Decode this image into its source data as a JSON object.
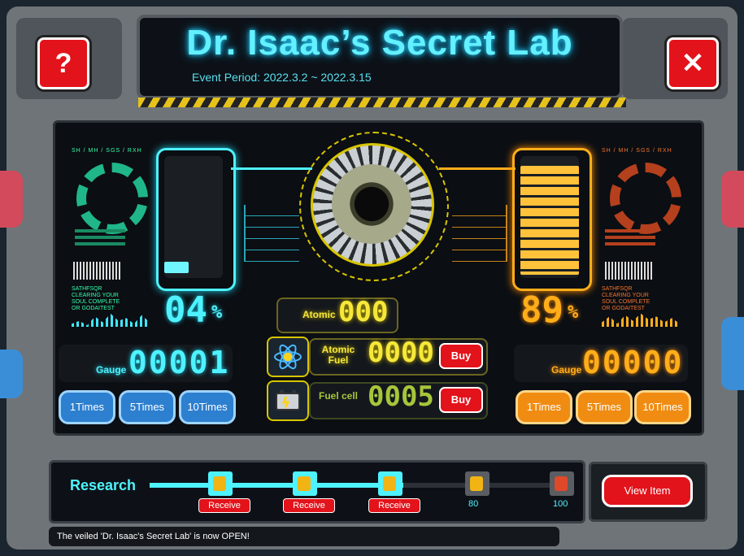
{
  "header": {
    "title": "Dr. Isaac’s Secret Lab",
    "event_period": "Event Period: 2022.3.2 ~ 2022.3.15"
  },
  "buttons": {
    "help_glyph": "?",
    "close_glyph": "✕"
  },
  "left": {
    "percent": "04",
    "percent_sign": "%",
    "gauge_label": "Gauge",
    "gauge_value": "00001",
    "fill_fraction": 0.04,
    "times": [
      "1Times",
      "5Times",
      "10Times"
    ],
    "tiny_header": "SH / MH / SGS / RXH",
    "tiny_text": "SATHFSQR\nCLEARING YOUR\nSOUL COMPLETE\nOR GODAITEST"
  },
  "right": {
    "percent": "89",
    "percent_sign": "%",
    "gauge_label": "Gauge",
    "gauge_value": "00000",
    "fill_fraction": 0.89,
    "times": [
      "1Times",
      "5Times",
      "10Times"
    ],
    "tiny_header": "SH / MH / SGS / RXH",
    "tiny_text": "SATHFSQR\nCLEARING YOUR\nSOUL COMPLETE\nOR GODAITEST"
  },
  "center": {
    "atomic_label": "Atomic",
    "atomic_value": "000",
    "atomic_fuel_label": "Atomic Fuel",
    "atomic_fuel_value": "0000",
    "fuel_cell_label": "Fuel cell",
    "fuel_cell_value": "0005",
    "buy_label": "Buy"
  },
  "research": {
    "title": "Research",
    "receive_label": "Receive",
    "milestones": [
      {
        "state": "receive",
        "value": ""
      },
      {
        "state": "receive",
        "value": ""
      },
      {
        "state": "receive",
        "value": ""
      },
      {
        "state": "locked",
        "value": "80"
      },
      {
        "state": "locked",
        "value": "100"
      }
    ],
    "view_item_label": "View Item"
  },
  "footer": {
    "message": "The veiled 'Dr. Isaac's Secret Lab' is now OPEN!"
  },
  "colors": {
    "cyan": "#4ef3ff",
    "orange": "#ffae1a",
    "yellow": "#f6e83a",
    "red": "#e3131b"
  }
}
